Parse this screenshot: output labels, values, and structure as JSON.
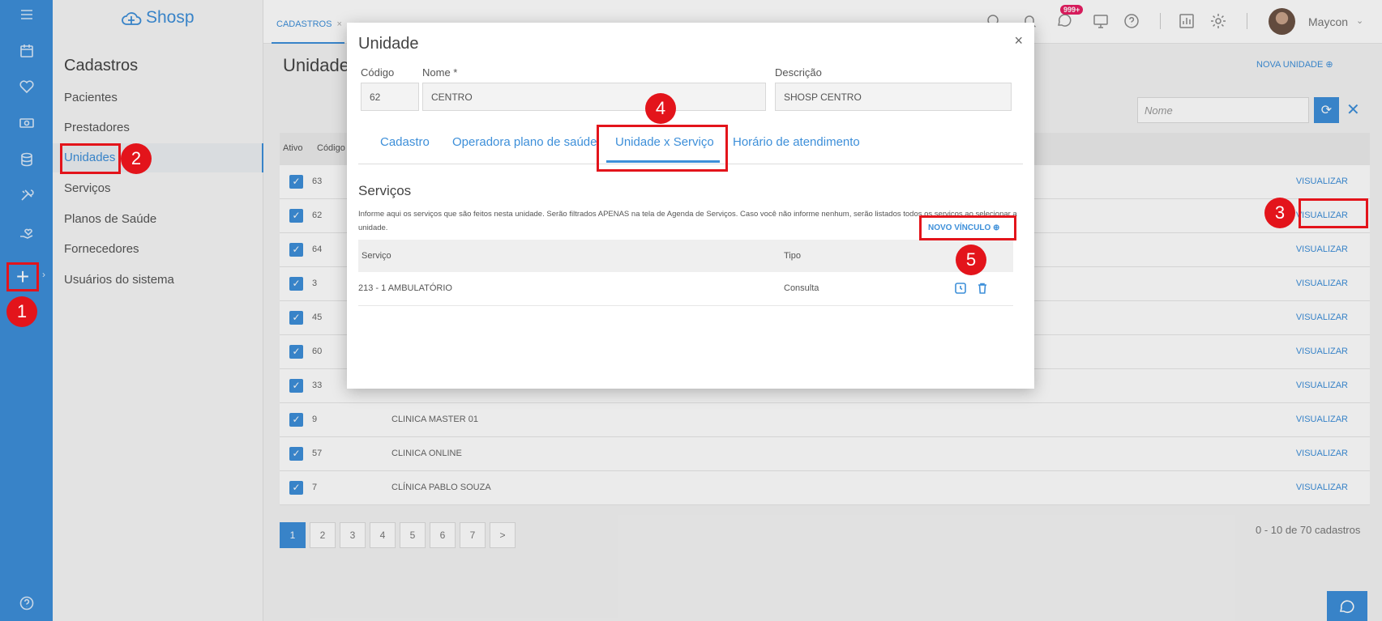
{
  "brand": {
    "name": "Shosp"
  },
  "sidebar": {
    "title": "Cadastros",
    "items": [
      {
        "label": "Pacientes"
      },
      {
        "label": "Prestadores"
      },
      {
        "label": "Unidades"
      },
      {
        "label": "Serviços"
      },
      {
        "label": "Planos de Saúde"
      },
      {
        "label": "Fornecedores"
      },
      {
        "label": "Usuários do sistema"
      }
    ]
  },
  "header": {
    "tab_label": "CADASTROS",
    "tab_close": "×",
    "badge": "999+",
    "user_name": "Maycon",
    "user_chevron": "⌄"
  },
  "main": {
    "title": "Unidades",
    "new_unit": "NOVA UNIDADE ⊕",
    "search_placeholder": "Nome",
    "refresh": "⟳",
    "clear": "✕",
    "columns": {
      "ativo": "Ativo",
      "codigo": "Código"
    },
    "rows": [
      {
        "code": "63",
        "name": "",
        "action": "VISUALIZAR"
      },
      {
        "code": "62",
        "name": "",
        "action": "VISUALIZAR"
      },
      {
        "code": "64",
        "name": "",
        "action": "VISUALIZAR"
      },
      {
        "code": "3",
        "name": "",
        "action": "VISUALIZAR"
      },
      {
        "code": "45",
        "name": "",
        "action": "VISUALIZAR"
      },
      {
        "code": "60",
        "name": "",
        "action": "VISUALIZAR"
      },
      {
        "code": "33",
        "name": "",
        "action": "VISUALIZAR"
      },
      {
        "code": "9",
        "name": "CLINICA MASTER 01",
        "action": "VISUALIZAR"
      },
      {
        "code": "57",
        "name": "CLINICA ONLINE",
        "action": "VISUALIZAR"
      },
      {
        "code": "7",
        "name": "CLÍNICA PABLO SOUZA",
        "action": "VISUALIZAR"
      }
    ],
    "pages": [
      "1",
      "2",
      "3",
      "4",
      "5",
      "6",
      "7",
      ">"
    ],
    "total": "0 - 10 de 70 cadastros"
  },
  "modal": {
    "title": "Unidade",
    "close": "×",
    "fields": {
      "codigo_label": "Código",
      "codigo_value": "62",
      "nome_label": "Nome *",
      "nome_value": "CENTRO",
      "descricao_label": "Descrição",
      "descricao_value": "SHOSP CENTRO"
    },
    "tabs": [
      {
        "label": "Cadastro"
      },
      {
        "label": "Operadora plano de saúde"
      },
      {
        "label": "Unidade x Serviço"
      },
      {
        "label": "Horário de atendimento"
      }
    ],
    "services": {
      "title": "Serviços",
      "description": "Informe aqui os serviços que são feitos nesta unidade. Serão filtrados APENAS na tela de Agenda de Serviços. Caso você não informe nenhum, serão listados todos os serviços ao selecionar a unidade.",
      "new_link": "NOVO VÍNCULO ⊕",
      "col_service": "Serviço",
      "col_type": "Tipo",
      "rows": [
        {
          "service": "213 - 1 AMBULATÓRIO",
          "type": "Consulta"
        }
      ]
    }
  },
  "annotations": {
    "step1": "1",
    "step2": "2",
    "step3": "3",
    "step4": "4",
    "step5": "5",
    "color": "#e3141b"
  },
  "colors": {
    "accent": "#3d8fd9",
    "badge": "#e91e63"
  }
}
